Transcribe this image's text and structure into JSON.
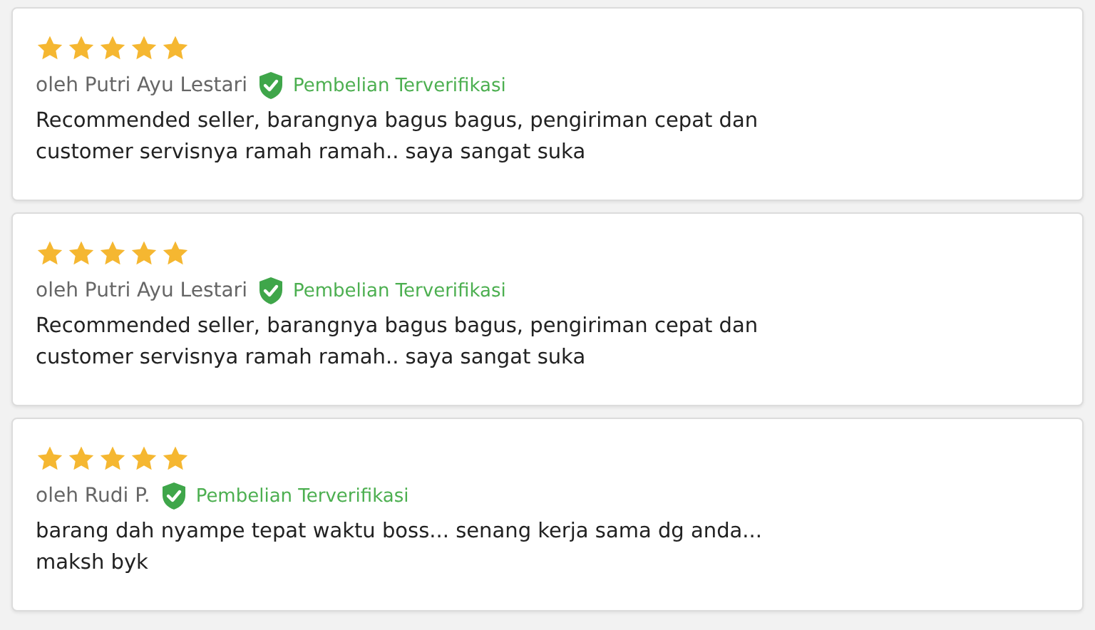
{
  "reviews": [
    {
      "stars": 5,
      "author": "oleh Putri Ayu Lestari",
      "verified": true,
      "badge": "Pembelian Terverifikasi",
      "text": "Recommended seller, barangnya bagus bagus, pengiriman cepat dan customer servisnya ramah ramah.. saya sangat suka"
    },
    {
      "stars": 5,
      "author": "oleh Putri Ayu Lestari",
      "verified": true,
      "badge": "Pembelian Terverifikasi",
      "text": "Recommended seller, barangnya bagus bagus, pengiriman cepat dan customer servisnya ramah ramah.. saya sangat suka"
    },
    {
      "stars": 5,
      "author": "oleh Rudi P.",
      "verified": true,
      "badge": "Pembelian Terverifikasi",
      "text": "barang dah nyampe tepat waktu boss... senang kerja sama dg anda... maksh byk"
    }
  ]
}
